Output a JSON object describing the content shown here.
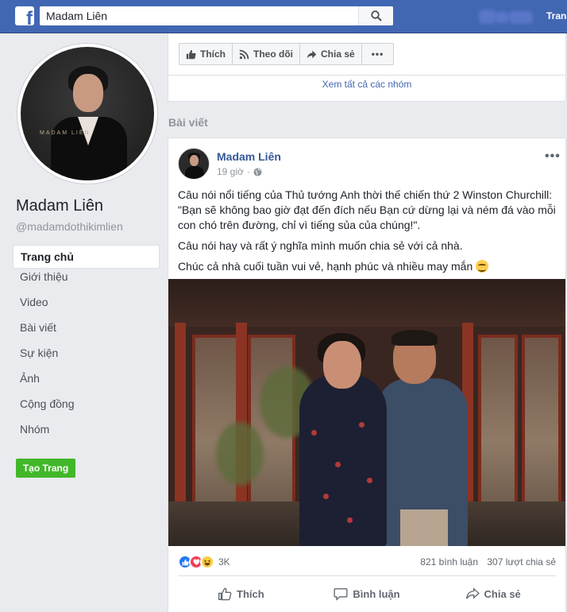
{
  "topbar": {
    "search_value": "Madam Liên",
    "right_link": "Tran"
  },
  "page": {
    "name": "Madam Liên",
    "handle": "@madamdothikimlien",
    "profile_watermark": "MADAM LIÊN"
  },
  "nav": {
    "items": [
      {
        "label": "Trang chủ",
        "active": true
      },
      {
        "label": "Giới thiệu"
      },
      {
        "label": "Video"
      },
      {
        "label": "Bài viết"
      },
      {
        "label": "Sự kiện"
      },
      {
        "label": "Ảnh"
      },
      {
        "label": "Cộng đồng"
      },
      {
        "label": "Nhóm"
      }
    ],
    "create_page": "Tạo Trang"
  },
  "actions": {
    "like": "Thích",
    "follow": "Theo dõi",
    "share": "Chia sẻ",
    "more": "•••",
    "see_groups": "Xem tất cả các nhóm"
  },
  "section_title": "Bài viết",
  "post": {
    "author": "Madam Liên",
    "time": "19 giờ",
    "more": "•••",
    "paragraphs": [
      "Câu nói nổi tiếng của Thủ tướng Anh thời thế chiến thứ 2 Winston Churchill: \"Bạn sẽ không bao giờ đạt đến đích nếu Bạn cứ dừng lại và ném đá vào mỗi con chó trên đường, chỉ vì tiếng sủa của chúng!\".",
      "Câu nói hay và rất ý nghĩa mình muốn chia sẻ với cả nhà.",
      "Chúc cả nhà cuối tuần vui vẻ, hạnh phúc và nhiều may mắn"
    ],
    "reaction_count": "3K",
    "comments": "821 bình luận",
    "shares": "307 lượt chia sẻ",
    "buttons": {
      "like": "Thích",
      "comment": "Bình luận",
      "share": "Chia sẻ"
    }
  },
  "colors": {
    "brand": "#4267b2",
    "link": "#365899",
    "create_button": "#42b72a"
  }
}
